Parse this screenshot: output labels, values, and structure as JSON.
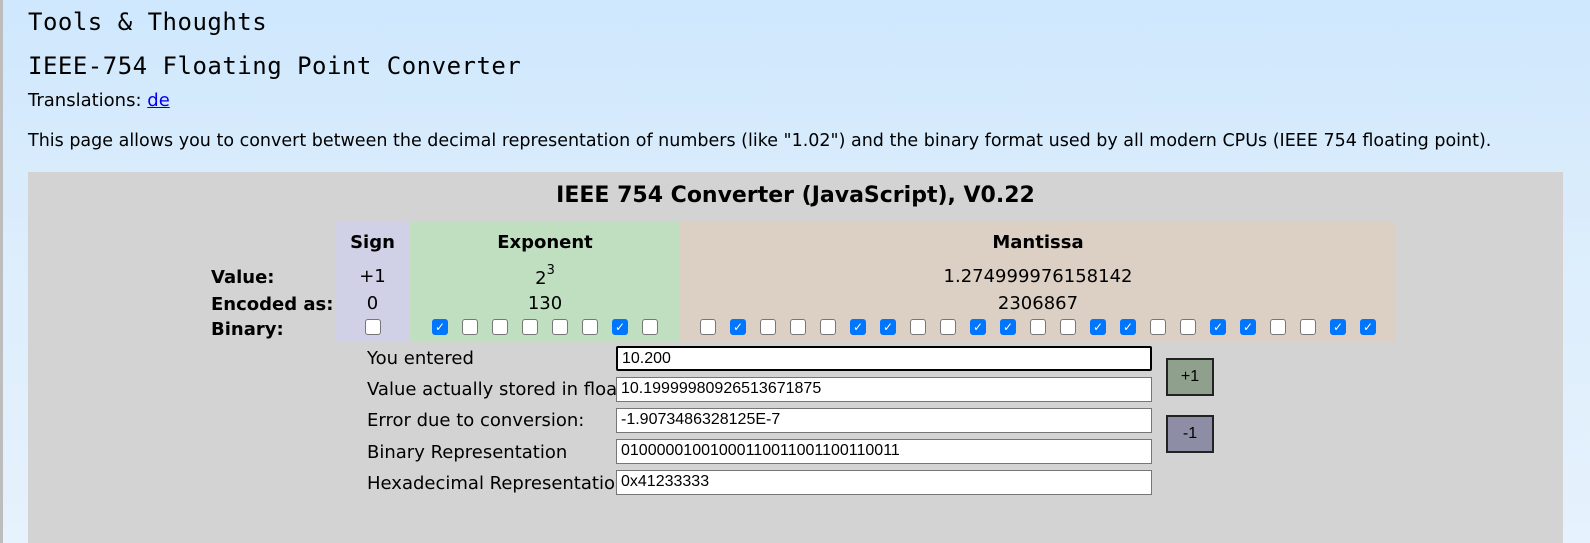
{
  "site_title": "Tools & Thoughts",
  "page_title": "IEEE-754 Floating Point Converter",
  "translations": {
    "label": "Translations:",
    "link": "de"
  },
  "intro": "This page allows you to convert between the decimal representation of numbers (like \"1.02\") and the binary format used by all modern CPUs (IEEE 754 floating point).",
  "converter": {
    "title": "IEEE 754 Converter (JavaScript), V0.22",
    "row_labels": {
      "value": "Value:",
      "encoded": "Encoded as:",
      "binary": "Binary:"
    },
    "sign": {
      "header": "Sign",
      "value": "+1",
      "encoded": "0",
      "bits": [
        0
      ]
    },
    "exponent": {
      "header": "Exponent",
      "value_base": "2",
      "value_power": "3",
      "encoded": "130",
      "bits": [
        1,
        0,
        0,
        0,
        0,
        0,
        1,
        0
      ]
    },
    "mantissa": {
      "header": "Mantissa",
      "value": "1.274999976158142",
      "encoded": "2306867",
      "bits": [
        0,
        1,
        0,
        0,
        0,
        1,
        1,
        0,
        0,
        1,
        1,
        0,
        0,
        1,
        1,
        0,
        0,
        1,
        1,
        0,
        0,
        1,
        1
      ]
    },
    "fields": {
      "entered": {
        "label": "You entered",
        "value": "10.200"
      },
      "stored": {
        "label": "Value actually stored in float:",
        "value": "10.19999980926513671875"
      },
      "error": {
        "label": "Error due to conversion:",
        "value": "-1.9073486328125E-7"
      },
      "binary": {
        "label": "Binary Representation",
        "value": "01000001001000110011001100110011"
      },
      "hex": {
        "label": "Hexadecimal Representation",
        "value": "0x41233333"
      }
    },
    "buttons": {
      "plus": "+1",
      "minus": "-1"
    }
  }
}
